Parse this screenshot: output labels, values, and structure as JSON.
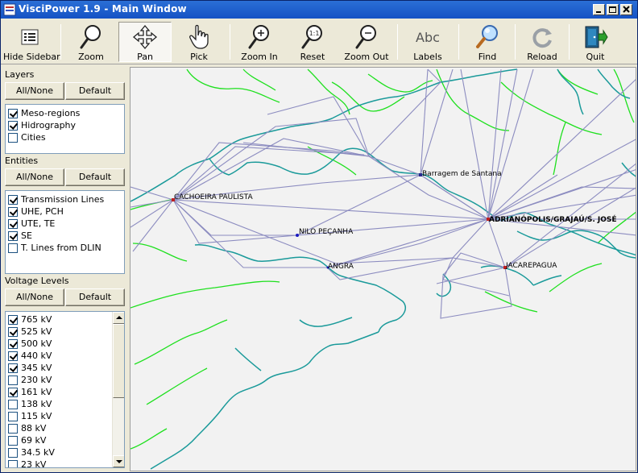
{
  "window": {
    "title": "VisciPower 1.9 - Main Window"
  },
  "toolbar": {
    "hide_sidebar": "Hide Sidebar",
    "zoom": "Zoom",
    "pan": "Pan",
    "pick": "Pick",
    "zoom_in": "Zoom In",
    "reset": "Reset",
    "zoom_out": "Zoom Out",
    "labels": "Labels",
    "find": "Find",
    "reload": "Reload",
    "quit": "Quit"
  },
  "sidebar": {
    "layers": {
      "title": "Layers",
      "all_none": "All/None",
      "default": "Default",
      "items": [
        {
          "label": "Meso-regions",
          "checked": true
        },
        {
          "label": "Hidrography",
          "checked": true
        },
        {
          "label": "Cities",
          "checked": false
        }
      ]
    },
    "entities": {
      "title": "Entities",
      "all_none": "All/None",
      "default": "Default",
      "items": [
        {
          "label": "Transmission Lines",
          "checked": true
        },
        {
          "label": "UHE, PCH",
          "checked": true
        },
        {
          "label": "UTE, TE",
          "checked": true
        },
        {
          "label": "SE",
          "checked": true
        },
        {
          "label": "T. Lines from DLIN",
          "checked": false
        }
      ]
    },
    "voltage": {
      "title": "Voltage Levels",
      "all_none": "All/None",
      "default": "Default",
      "items": [
        {
          "label": "765 kV",
          "checked": true
        },
        {
          "label": "525 kV",
          "checked": true
        },
        {
          "label": "500 kV",
          "checked": true
        },
        {
          "label": "440 kV",
          "checked": true
        },
        {
          "label": "345 kV",
          "checked": true
        },
        {
          "label": "230 kV",
          "checked": false
        },
        {
          "label": "161 kV",
          "checked": true
        },
        {
          "label": "138 kV",
          "checked": false
        },
        {
          "label": "115 kV",
          "checked": false
        },
        {
          "label": "88 kV",
          "checked": false
        },
        {
          "label": "69 kV",
          "checked": false
        },
        {
          "label": "34.5 kV",
          "checked": false
        },
        {
          "label": "23 kV",
          "checked": false
        }
      ]
    }
  },
  "map": {
    "labels": {
      "cachoeira": "CACHOEIRA PAULISTA",
      "barragem": "Barragem de Santana",
      "adrianopolis": "ADRIANÓPOLIS/GRAJAÚ/S. JOSÉ",
      "nilo": "NILO PEÇANHA",
      "angra": "ANGRA",
      "jacarepagua": "JACAREPAGUA"
    },
    "colors": {
      "rivers": "#1ee01e",
      "coast": "#1a9a9a",
      "lines": "#8c8cc0"
    }
  }
}
